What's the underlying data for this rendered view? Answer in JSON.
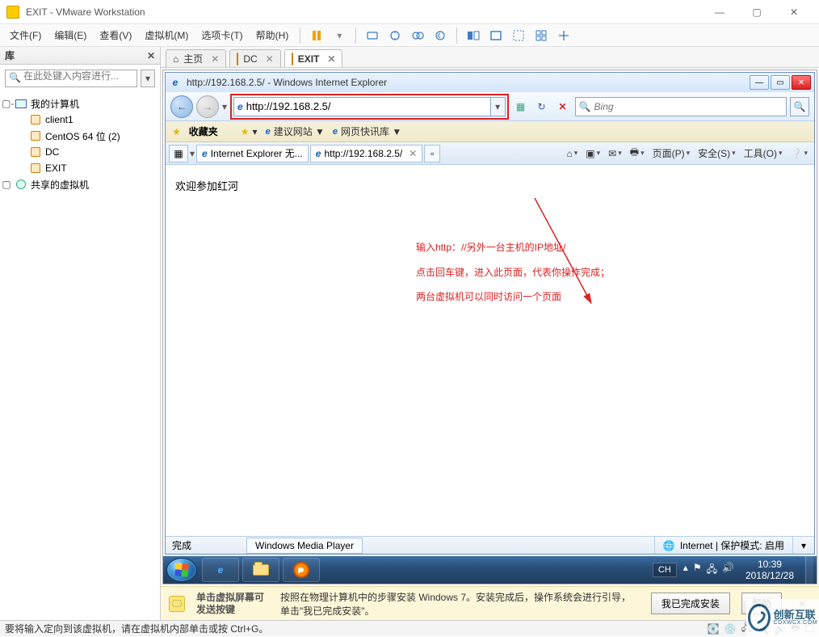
{
  "app": {
    "title": "EXIT - VMware Workstation",
    "menus": [
      "文件(F)",
      "编辑(E)",
      "查看(V)",
      "虚拟机(M)",
      "选项卡(T)",
      "帮助(H)"
    ]
  },
  "library": {
    "header": "库",
    "search_placeholder": "在此处键入内容进行...",
    "root": {
      "label": "我的计算机",
      "expanded": true
    },
    "items": [
      {
        "label": "client1",
        "type": "vm"
      },
      {
        "label": "CentOS 64 位 (2)",
        "type": "vm"
      },
      {
        "label": "DC",
        "type": "vm"
      },
      {
        "label": "EXIT",
        "type": "vm",
        "selected": false
      }
    ],
    "shared": {
      "label": "共享的虚拟机",
      "expanded": true
    }
  },
  "vm_tabs": [
    {
      "icon": "home-icon",
      "label": "主页",
      "closable": true
    },
    {
      "icon": "vm-icon",
      "label": "DC",
      "closable": true
    },
    {
      "icon": "vm-icon",
      "label": "EXIT",
      "closable": true,
      "active": true
    }
  ],
  "ie": {
    "window_title": "http://192.168.2.5/ - Windows Internet Explorer",
    "address": "http://192.168.2.5/",
    "search_placeholder": "Bing",
    "favorites_label": "收藏夹",
    "fav_links": [
      "建议网站 ▼",
      "网页快讯库 ▼"
    ],
    "tabs": [
      {
        "label": "Internet Explorer 无..."
      },
      {
        "label": "http://192.168.2.5/"
      }
    ],
    "tools": {
      "page": "页面(P)",
      "safety": "安全(S)",
      "tools": "工具(O)"
    },
    "page_body": "欢迎参加红河",
    "annotation_line1": "输入http：//另外一台主机的IP地址/",
    "annotation_line2": "点击回车键，进入此页面，代表你操作完成；",
    "annotation_line3": "两台虚拟机可以同时访问一个页面",
    "status_left": "完成",
    "status_wmp": "Windows Media Player",
    "status_zone": "Internet | 保护模式: 启用"
  },
  "taskbar": {
    "lang": "CH",
    "time": "10:39",
    "date": "2018/12/28"
  },
  "hint": {
    "left": "单击虚拟屏幕可发送按键",
    "main": "按照在物理计算机中的步骤安装 Windows 7。安装完成后，操作系统会进行引导，单击\"我已完成安装\"。",
    "done_btn": "我已完成安装",
    "help_btn": "帮助"
  },
  "vm_status": "要将输入定向到该虚拟机，请在虚拟机内部单击或按 Ctrl+G。",
  "watermark": {
    "brand": "创新互联",
    "sub": "CDXWCX.COM"
  }
}
